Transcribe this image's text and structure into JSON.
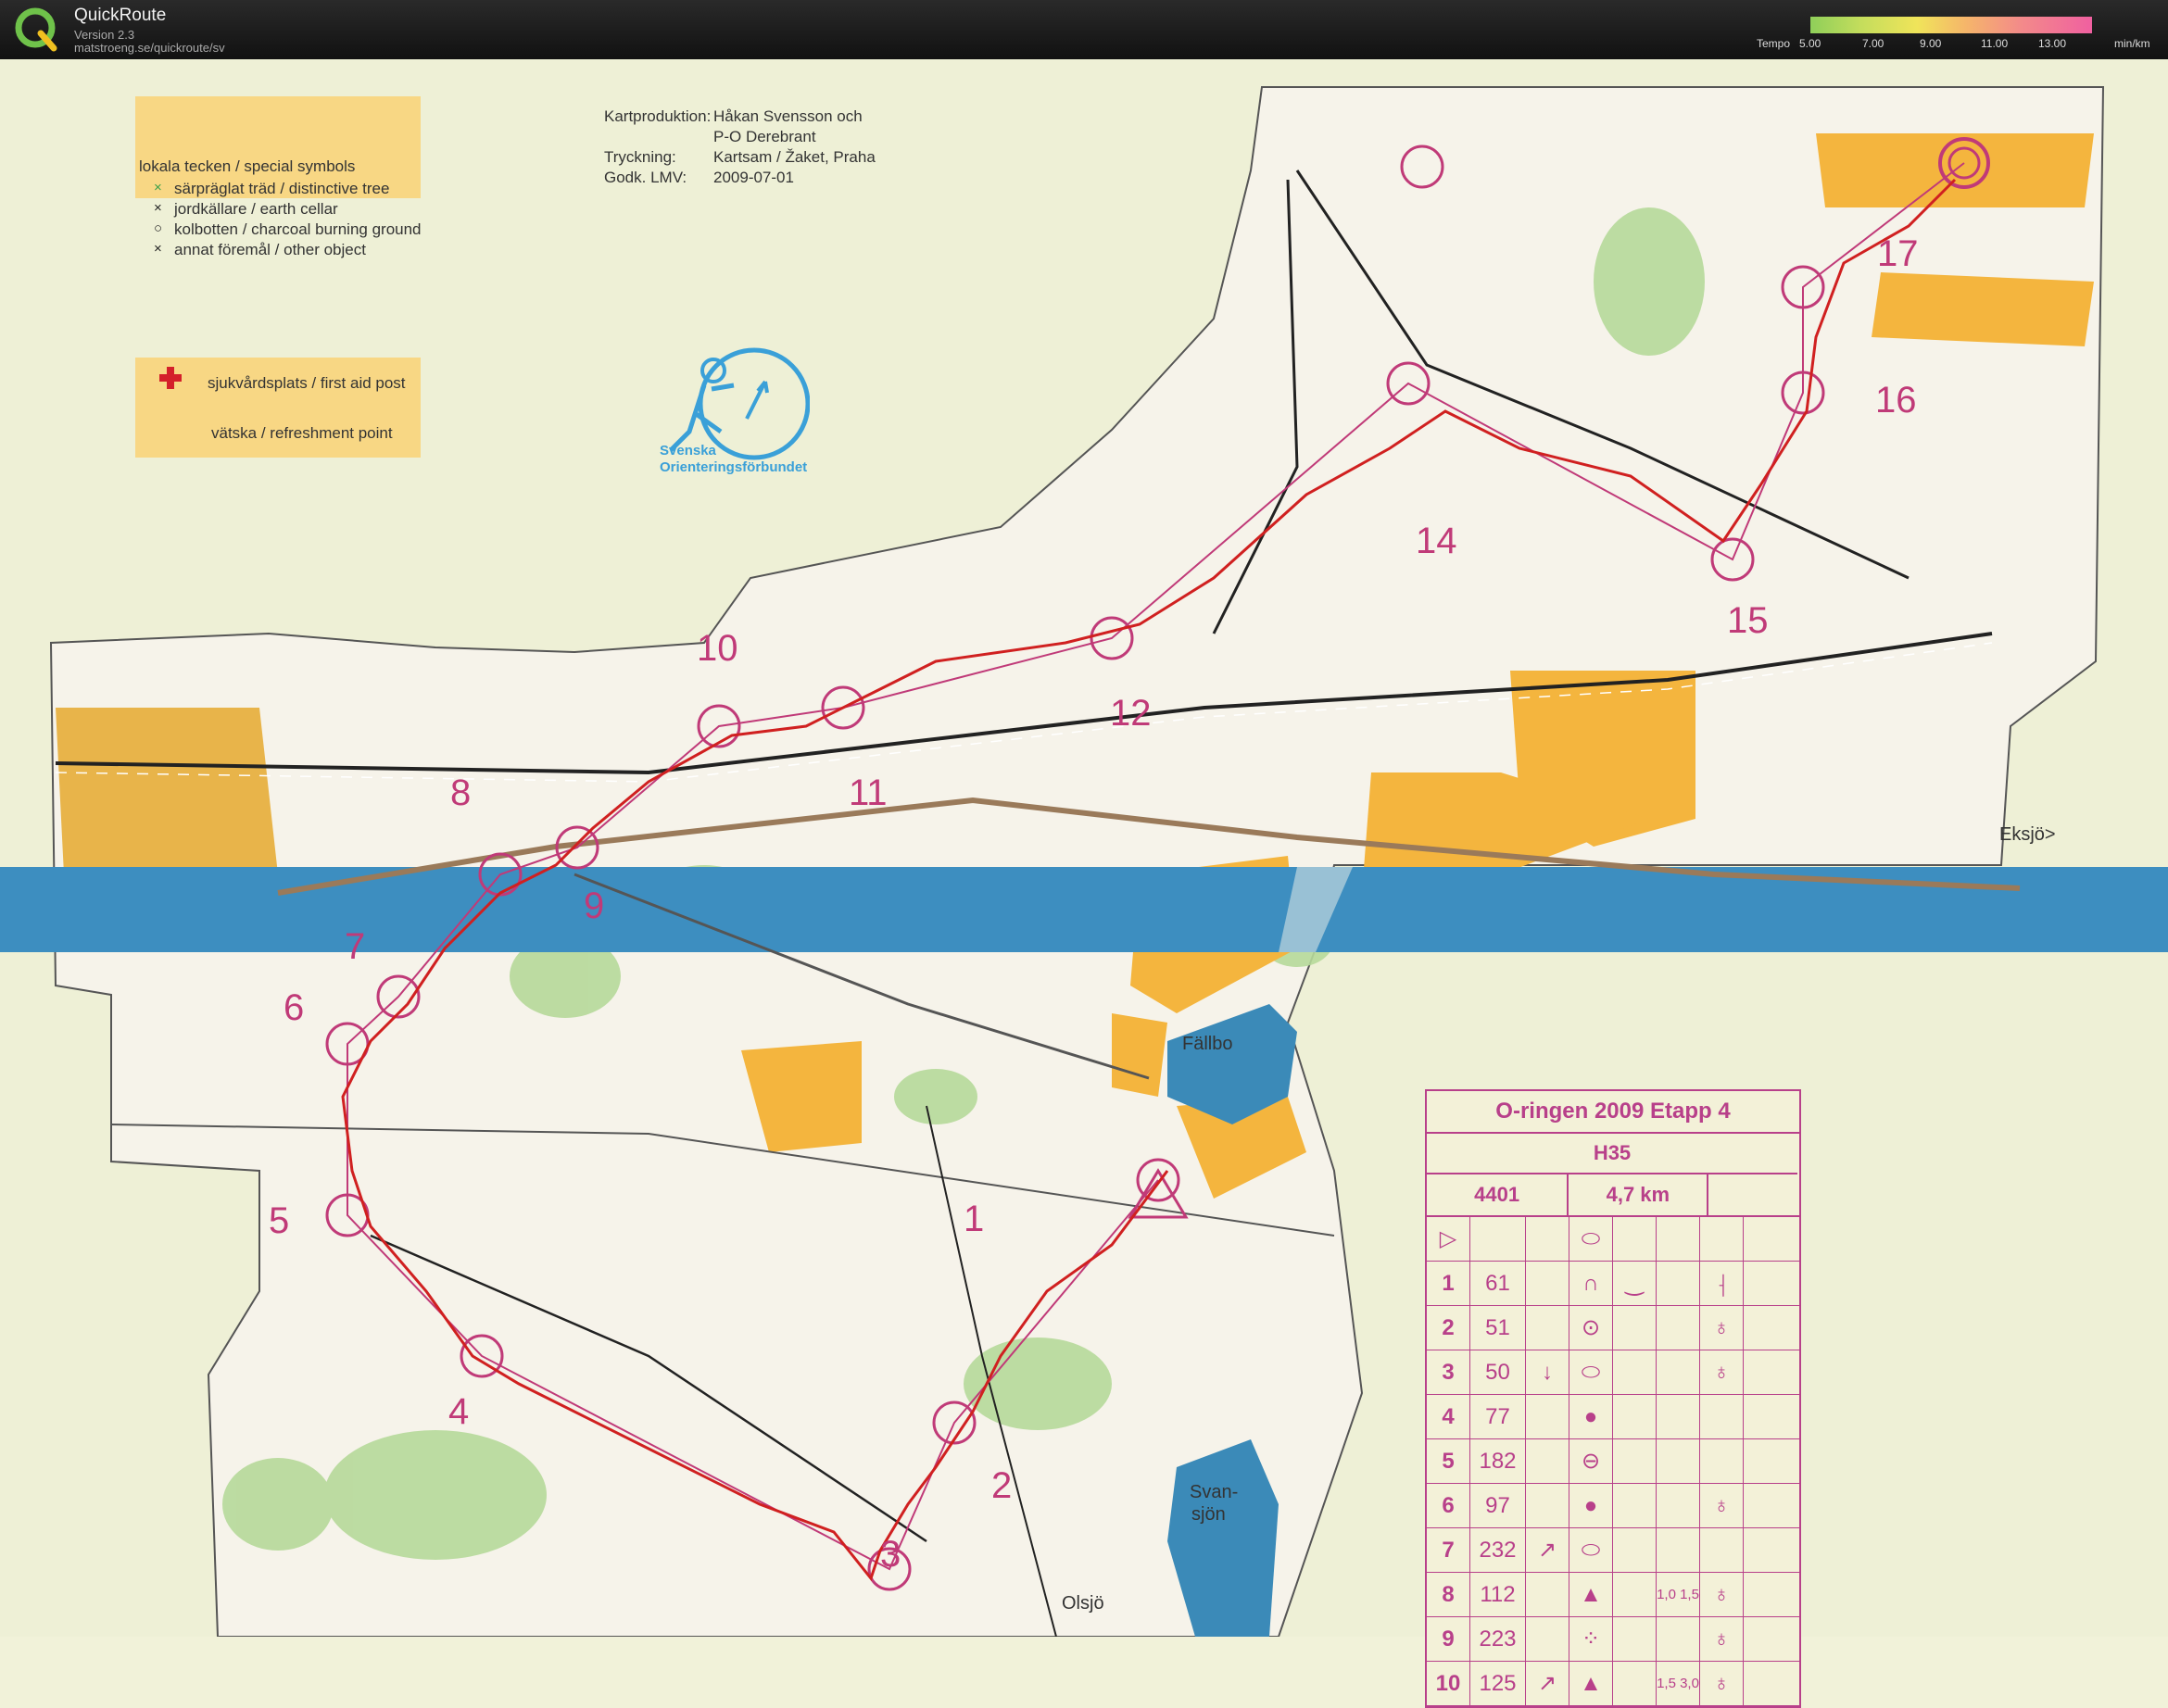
{
  "app": {
    "name": "QuickRoute",
    "version": "Version 2.3",
    "url": "matstroeng.se/quickroute/sv",
    "tempo_label": "Tempo",
    "tempo_ticks": [
      "5.00",
      "7.00",
      "9.00",
      "11.00",
      "13.00"
    ],
    "tempo_unit": "min/km"
  },
  "legend": {
    "title": "lokala tecken / special symbols",
    "items": [
      {
        "symbol": "×",
        "label": "särpräglat träd / distinctive tree",
        "color": "#3aa04a"
      },
      {
        "symbol": "×",
        "label": "jordkällare / earth cellar",
        "color": "#222222"
      },
      {
        "symbol": "○",
        "label": "kolbotten / charcoal burning ground",
        "color": "#222222"
      },
      {
        "symbol": "×",
        "label": "annat föremål / other object",
        "color": "#222222"
      }
    ],
    "first_aid": "sjukvårdsplats / first aid post",
    "refreshment": "vätska / refreshment point"
  },
  "credits": [
    {
      "label": "Kartproduktion:",
      "value": "Håkan Svensson och"
    },
    {
      "label": "",
      "value": "P-O Derebrant"
    },
    {
      "label": "Tryckning:",
      "value": "Kartsam / Žaket, Praha"
    },
    {
      "label": "Godk. LMV:",
      "value": "2009-07-01"
    }
  ],
  "org": {
    "line1": "Svenska",
    "line2": "Orienteringsförbundet"
  },
  "place_names": [
    "Fällbo",
    "Svan-",
    "sjön",
    "Olsjö",
    "Eksjö>"
  ],
  "control_labels": [
    "1",
    "2",
    "3",
    "4",
    "5",
    "6",
    "7",
    "8",
    "9",
    "10",
    "11",
    "12",
    "14",
    "15",
    "16",
    "17"
  ],
  "control_description": {
    "title": "O-ringen 2009 Etapp 4",
    "class": "H35",
    "course": "4401",
    "length": "4,7 km",
    "start_symbol": "▷",
    "start_feature": "⬭",
    "rows": [
      {
        "num": "1",
        "code": "61",
        "dir": "",
        "feature": "∩",
        "detail": "‿",
        "dims": "",
        "pos": "⸡"
      },
      {
        "num": "2",
        "code": "51",
        "dir": "",
        "feature": "⊙",
        "detail": "",
        "dims": "",
        "pos": "♁"
      },
      {
        "num": "3",
        "code": "50",
        "dir": "↓",
        "feature": "⬭",
        "detail": "",
        "dims": "",
        "pos": "♁"
      },
      {
        "num": "4",
        "code": "77",
        "dir": "",
        "feature": "●",
        "detail": "",
        "dims": "",
        "pos": ""
      },
      {
        "num": "5",
        "code": "182",
        "dir": "",
        "feature": "⊖",
        "detail": "",
        "dims": "",
        "pos": ""
      },
      {
        "num": "6",
        "code": "97",
        "dir": "",
        "feature": "●",
        "detail": "",
        "dims": "",
        "pos": "♁"
      },
      {
        "num": "7",
        "code": "232",
        "dir": "↗",
        "feature": "⬭",
        "detail": "",
        "dims": "",
        "pos": ""
      },
      {
        "num": "8",
        "code": "112",
        "dir": "",
        "feature": "▲",
        "detail": "",
        "dims": "1,0 1,5",
        "pos": "♁"
      },
      {
        "num": "9",
        "code": "223",
        "dir": "",
        "feature": "⁘",
        "detail": "",
        "dims": "",
        "pos": "♁"
      },
      {
        "num": "10",
        "code": "125",
        "dir": "↗",
        "feature": "▲",
        "detail": "",
        "dims": "1,5 3,0",
        "pos": "♁"
      }
    ]
  },
  "colors": {
    "course": "#c03a78",
    "route": "#d02020",
    "water": "#3b8ab8",
    "yellow": "#f3b43a",
    "forest": "#f7f5ec",
    "green": "#a9d38c"
  }
}
